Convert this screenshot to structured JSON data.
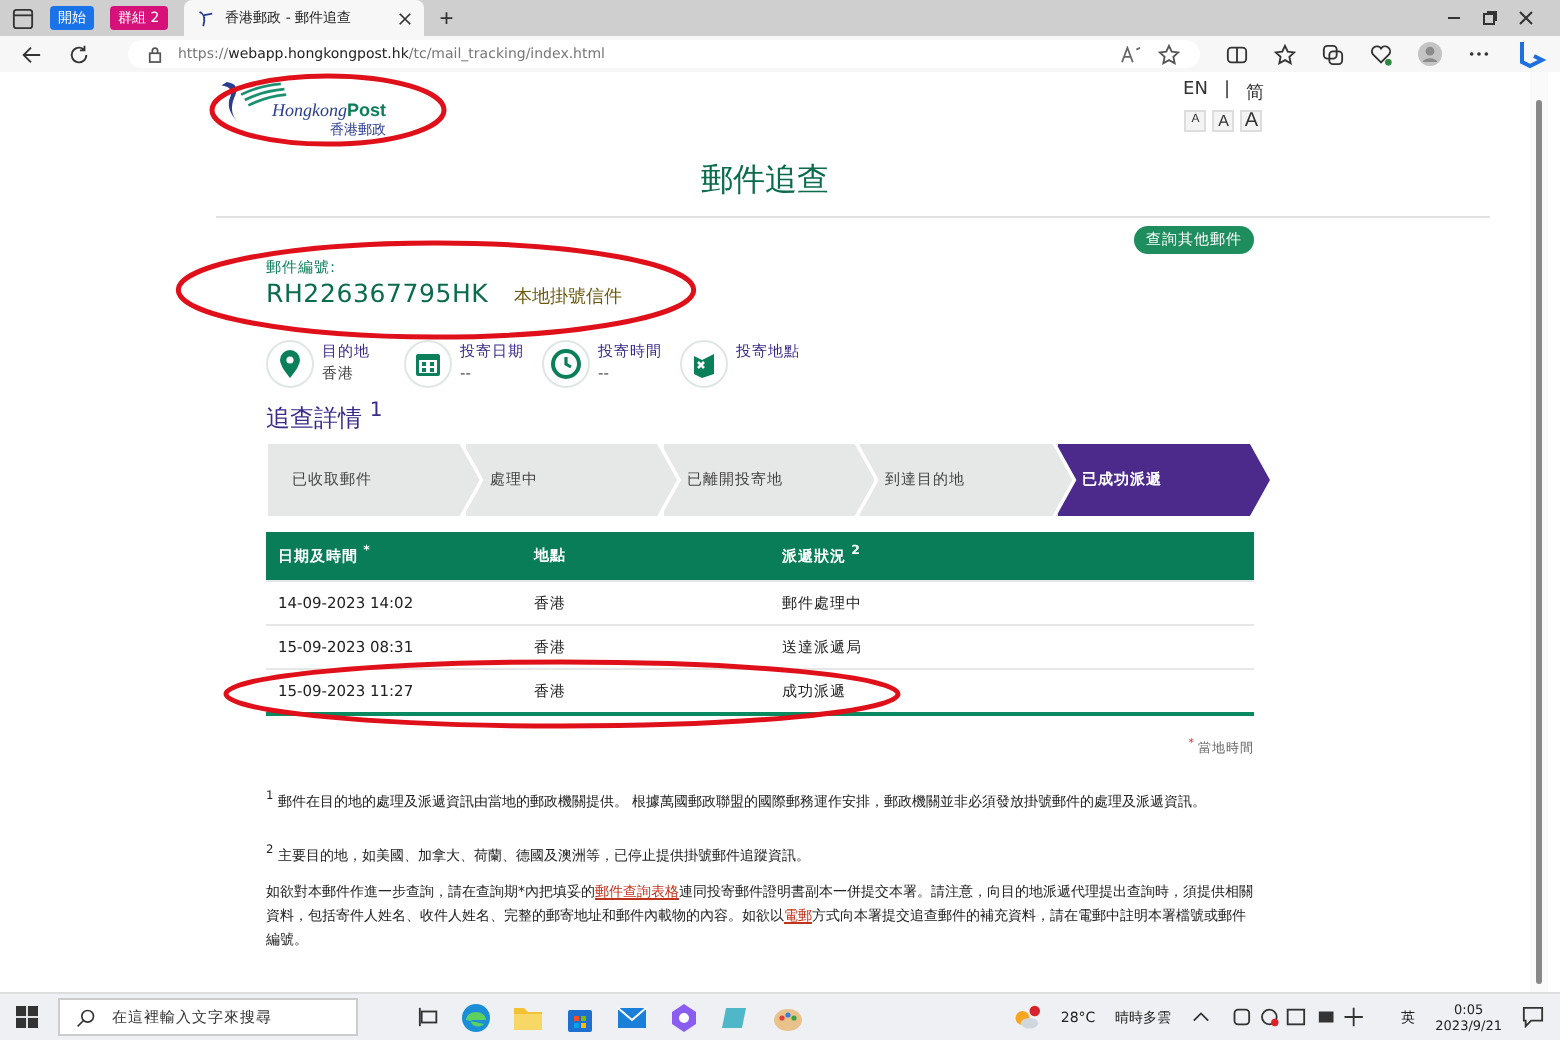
{
  "browser": {
    "tab_groups": [
      {
        "label": "開始",
        "color": "#1a73e8"
      },
      {
        "label": "群組 2",
        "color": "#d6127a"
      }
    ],
    "tab": {
      "title": "香港郵政 - 郵件追查"
    },
    "new_tab": "+",
    "url": {
      "prefix": "https://",
      "host": "webapp.hongkongpost.hk",
      "path": "/tc/mail_tracking/index.html"
    }
  },
  "header": {
    "logo_en_1": "Hongkong",
    "logo_en_2": "Post",
    "logo_zh": "香港郵政",
    "lang_en": "EN",
    "lang_sep": "|",
    "lang_sc": "简",
    "font_sizes": [
      {
        "label": "A",
        "selected": false
      },
      {
        "label": "A",
        "selected": false
      },
      {
        "label": "A",
        "selected": false
      }
    ]
  },
  "title": "郵件追查",
  "other_button": "查詢其他郵件",
  "item": {
    "label": "郵件編號:",
    "number": "RH226367795HK",
    "type": "本地掛號信件"
  },
  "facts": [
    {
      "kind": "pin",
      "label": "目的地",
      "value": "香港"
    },
    {
      "kind": "calendar",
      "label": "投寄日期",
      "value": "--"
    },
    {
      "kind": "clock",
      "label": "投寄時間",
      "value": "--"
    },
    {
      "kind": "map",
      "label": "投寄地點"
    }
  ],
  "details_title": "追查詳情 $^{1}$",
  "steps": [
    {
      "label": "已收取郵件",
      "selected": false
    },
    {
      "label": "處理中",
      "selected": false
    },
    {
      "label": "已離開投寄地",
      "selected": false
    },
    {
      "label": "到達目的地",
      "selected": false
    },
    {
      "label": "已成功派遞",
      "selected": true
    }
  ],
  "table": {
    "columns": [
      "日期及時間 $^{*}$",
      "地點",
      "派遞狀況 $^{2}$"
    ],
    "rows": [
      [
        "14-09-2023 14:02",
        "香港",
        "郵件處理中"
      ],
      [
        "15-09-2023 08:31",
        "香港",
        "送達派遞局"
      ],
      [
        "15-09-2023 11:27",
        "香港",
        "成功派遞"
      ]
    ]
  },
  "local_time_note": "$^{*}$ 當地時間",
  "footnotes": [
    [
      {
        "text": "$^{1}$ 郵件在目的地的處理及派遞資訊由當地的郵政機關提供。 根據萬國郵政聯盟的國際郵務運作安排，郵政機關並非必須發放掛號郵件的處理及派遞資訊。"
      }
    ],
    [
      {
        "text": "$^{2}$ 主要目的地，如美國、加拿大、荷蘭、德國及澳洲等，已停止提供掛號郵件追蹤資訊。"
      }
    ],
    [
      {
        "text": "如欲對本郵件作進一步查詢，請在查詢期*內把填妥的"
      },
      {
        "text": "郵件查詢表格",
        "link": true
      },
      {
        "text": "連同投寄郵件證明書副本一併提交本署。請注意，向目的地派遞代理提出查詢時，須提供相關資料，包括寄件人姓名、收件人姓名、完整的郵寄地址和郵件內載物的內容。如欲以"
      },
      {
        "text": "電郵",
        "link": true
      },
      {
        "text": "方式向本署提交追查郵件的補充資料，請在電郵中註明本署檔號或郵件編號。"
      }
    ]
  ],
  "taskbar": {
    "search_placeholder": "在這裡輸入文字來搜尋",
    "temperature": "28°C",
    "weather": "晴時多雲",
    "ime": "英",
    "time": "0:05",
    "date": "2023/9/21"
  }
}
